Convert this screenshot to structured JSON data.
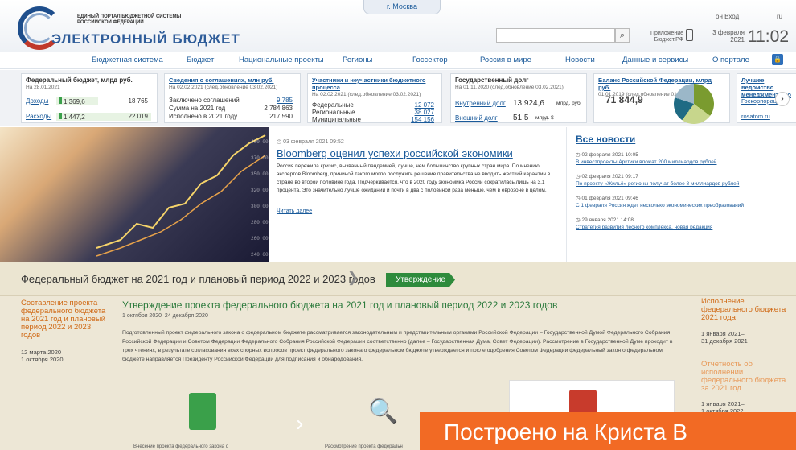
{
  "header": {
    "portal_line1": "ЕДИНЫЙ ПОРТАЛ БЮДЖЕТНОЙ СИСТЕМЫ",
    "portal_line2": "РОССИЙСКОЙ ФЕДЕРАЦИИ",
    "brand": "ЭЛЕКТРОННЫЙ БЮДЖЕТ",
    "city": "г. Москва",
    "login": "Вход",
    "lang": "ru",
    "app_label_1": "Приложение",
    "app_label_2": "Бюджет.РФ",
    "date_line1": "3 февраля",
    "date_line2": "2021",
    "time": "11:02",
    "search_placeholder": ""
  },
  "nav": [
    "Бюджетная система",
    "Бюджет",
    "Национальные проекты",
    "Регионы",
    "Госсектор",
    "Россия в мире",
    "Новости",
    "Данные и сервисы",
    "О портале"
  ],
  "cards": {
    "fed": {
      "title": "Федеральный бюджет, млрд руб.",
      "date": "На 28.01.2021",
      "income_label": "Доходы",
      "income_val": "1 369,6",
      "income_val2": "18 765",
      "expense_label": "Расходы",
      "expense_val": "1 447,2",
      "expense_val2": "22 019"
    },
    "agr": {
      "title": "Сведения о соглашениях, млн руб.",
      "date": "На 02.02.2021 (след.обновление 03.02.2021)",
      "r1": "Заключено соглашений",
      "v1": "9 785",
      "r2": "Сумма на 2021 год",
      "v2": "2 784 863",
      "r3": "Исполнено в 2021 году",
      "v3": "217 590"
    },
    "part": {
      "title1": "Участники и неучастники бюджетного",
      "title2": "процесса",
      "date": "На 02.02.2021 (след.обновление 03.02.2021)",
      "r1": "Федеральные",
      "v1": "12 072",
      "r2": "Региональные",
      "v2": "38 027",
      "r3": "Муниципальные",
      "v3": "154 156"
    },
    "debt": {
      "title": "Государственный долг",
      "date": "На 01.11.2020 (след.обновление 03.02.2021)",
      "r1": "Внутренний долг",
      "v1": "13 924,6",
      "u1": "млрд. руб.",
      "r2": "Внешний долг",
      "v2": "51,5",
      "u2": "млрд. $"
    },
    "balance": {
      "title": "Баланс Российской Федерации, млрд руб.",
      "date": "01.01.2019 (след.обновление 01.06.2021)",
      "value": "71 844,9"
    },
    "best": {
      "title1": "Лучшее ведомство",
      "title2": "менеджменту по",
      "l1": "Госкорпорац...",
      "l2": "rosatom.ru"
    }
  },
  "news": {
    "date": "03 февраля 2021 09:52",
    "title": "Bloomberg оценил успехи российской экономики",
    "body": "Россия пережила кризис, вызванный пандемией, лучше, чем большинство крупных стран мира. По мнению экспертов Bloomberg, причиной такого могло послужить решение правительства не вводить жесткий карантин в стране во второй половине года. Подчеркивается, что в 2020 году экономика России сократилась лишь на 3,1 процента. Это значительно лучше ожиданий и почти в два с половиной раза меньше, чем в еврозоне в целом.",
    "more": "Читать далее",
    "all": "Все новости",
    "items": [
      {
        "date": "02 февраля 2021 10:05",
        "text": "В инвестпроекты Арктики вложат 200 миллиардов рублей"
      },
      {
        "date": "02 февраля 2021 09:17",
        "text": "По проекту «Жильё» регионы получат более 8 миллиардов рублей"
      },
      {
        "date": "01 февраля 2021 09:46",
        "text": "С 1 февраля Россия ждет несколько экономических преобразований"
      },
      {
        "date": "29 января 2021 14:08",
        "text": "Стратегия развития лесного комплекса, новая редакция"
      }
    ]
  },
  "budget": {
    "title": "Федеральный бюджет на 2021 год и плановый период 2022 и 2023 годов",
    "badge": "Утверждение",
    "left": "Составление проекта федерального бюджета на 2021 год и плановый период 2022 и 2023 годов",
    "left_d1": "12 марта 2020–",
    "left_d2": "1 октября 2020",
    "main_title": "Утверждение проекта федерального бюджета на 2021 год и плановый период 2022 и 2023 годов",
    "main_dates": "1 октября 2020–24 декабря 2020",
    "main_body": "Подготовленный проект федерального закона о федеральном бюджете рассматривается законодательным и представительным органами Российской Федерации – Государственной Думой Федерального Собрания Российской Федерации и Советом Федерации Федерального Собрания Российской Федерации соответственно (далее – Государственная Дума, Совет Федерации). Рассмотрение в Государственной Думе проходит в трех чтениях, в результате согласования всех спорных вопросов проект федерального закона о федеральном бюджете утверждается и после одобрения Советом Федерации федеральный закон о федеральном бюджете направляется Президенту Российской Федерации для подписания и обнародования.",
    "right1": "Исполнение федерального бюджета 2021 года",
    "right1_d1": "1 января 2021–",
    "right1_d2": "31 декабря 2021",
    "right2": "Отчетность об исполнении федерального бюджета за 2021 год",
    "right2_d1": "1 января 2021–",
    "right2_d2": "1 октября 2022",
    "cap1": "Внесение проекта федерального закона о",
    "cap2": "Рассмотрение проекта федеральн"
  },
  "banner": "Построено на Криста В"
}
